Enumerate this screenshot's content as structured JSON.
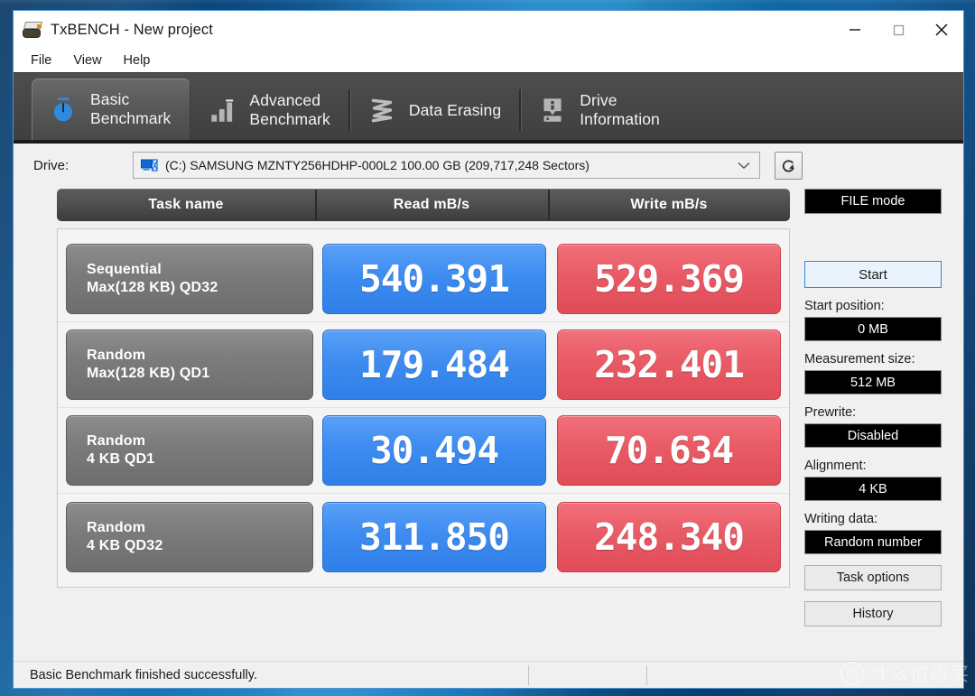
{
  "window": {
    "title": "TxBENCH - New project",
    "icon": "app-icon",
    "controls": {
      "minimize": "minimize-icon",
      "maximize": "maximize-icon",
      "close": "close-icon"
    }
  },
  "menubar": {
    "items": [
      "File",
      "View",
      "Help"
    ]
  },
  "tabs": [
    {
      "label": "Basic\nBenchmark",
      "icon": "stopwatch-icon",
      "active": true
    },
    {
      "label": "Advanced\nBenchmark",
      "icon": "bar-chart-icon",
      "active": false
    },
    {
      "label": "Data Erasing",
      "icon": "shred-icon",
      "active": false
    },
    {
      "label": "Drive\nInformation",
      "icon": "drive-info-icon",
      "active": false
    }
  ],
  "drive": {
    "label": "Drive:",
    "icon": "disk-icon",
    "value": "(C:) SAMSUNG MZNTY256HDHP-000L2  100.00 GB (209,717,248 Sectors)",
    "dropdown_icon": "chevron-down-icon",
    "refresh_icon": "refresh-icon"
  },
  "table": {
    "headers": [
      "Task name",
      "Read mB/s",
      "Write mB/s"
    ],
    "rows": [
      {
        "name_line1": "Sequential",
        "name_line2": "Max(128 KB) QD32",
        "read": "540.391",
        "write": "529.369"
      },
      {
        "name_line1": "Random",
        "name_line2": "Max(128 KB) QD1",
        "read": "179.484",
        "write": "232.401"
      },
      {
        "name_line1": "Random",
        "name_line2": "4 KB QD1",
        "read": "30.494",
        "write": "70.634"
      },
      {
        "name_line1": "Random",
        "name_line2": "4 KB QD32",
        "read": "311.850",
        "write": "248.340"
      }
    ]
  },
  "sidebar": {
    "file_mode": "FILE mode",
    "start": "Start",
    "options": [
      {
        "label": "Start position:",
        "value": "0 MB"
      },
      {
        "label": "Measurement size:",
        "value": "512 MB"
      },
      {
        "label": "Prewrite:",
        "value": "Disabled"
      },
      {
        "label": "Alignment:",
        "value": "4 KB"
      },
      {
        "label": "Writing data:",
        "value": "Random number"
      }
    ],
    "task_options": "Task options",
    "history": "History"
  },
  "statusbar": {
    "message": "Basic Benchmark finished successfully."
  },
  "watermark": {
    "badge": "值",
    "text": "什么值得买"
  },
  "colors": {
    "read_bar": "#3e8cf0",
    "write_bar": "#e85b66",
    "task_bar": "#7c7c7c",
    "tabstrip": "#474747",
    "accent_blue": "#2f8ae0",
    "field_bg": "#000000"
  }
}
